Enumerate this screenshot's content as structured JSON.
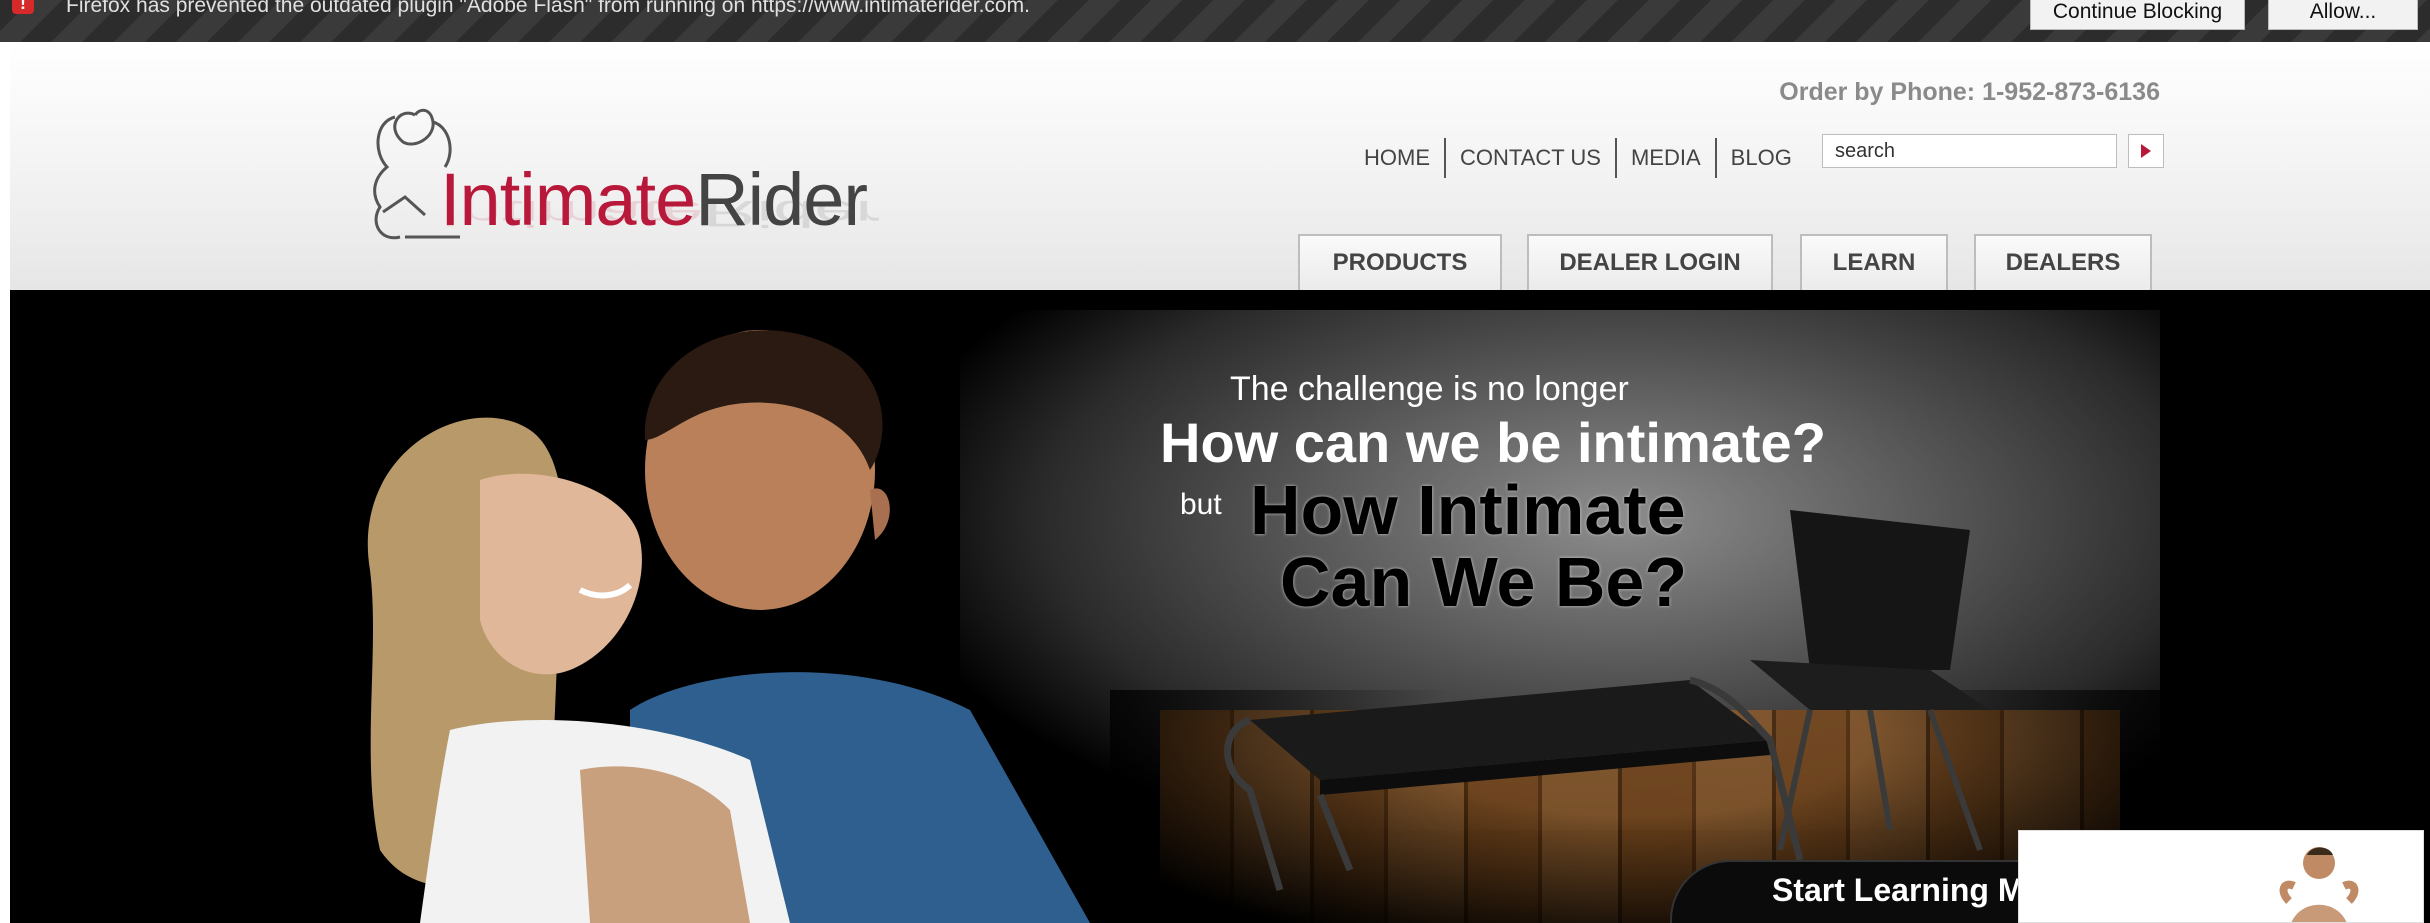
{
  "notification": {
    "message": "Firefox has prevented the outdated plugin \"Adobe Flash\" from running on https://www.intimaterider.com.",
    "continue_label": "Continue Blocking",
    "allow_label": "Allow...",
    "icon": "plugin-warning-icon"
  },
  "header": {
    "logo": {
      "brand_left": "Intimate",
      "brand_right": "Rider"
    },
    "phone": "Order by Phone: 1-952-873-6136",
    "top_nav": [
      "HOME",
      "CONTACT US",
      "MEDIA",
      "BLOG"
    ],
    "search": {
      "placeholder": "search",
      "value": "search",
      "button_icon": "arrow-right-icon"
    },
    "main_nav": [
      "PRODUCTS",
      "DEALER LOGIN",
      "LEARN",
      "DEALERS"
    ]
  },
  "hero": {
    "line1": "The challenge is no longer",
    "line2": "How can we be intimate?",
    "but": "but",
    "line3": "How Intimate",
    "line4": "Can We Be?",
    "cta": "Start Learning M"
  },
  "colors": {
    "brand": "#b8193a",
    "notification_bg": "#2c2c2c",
    "hero_bg": "#000000"
  }
}
